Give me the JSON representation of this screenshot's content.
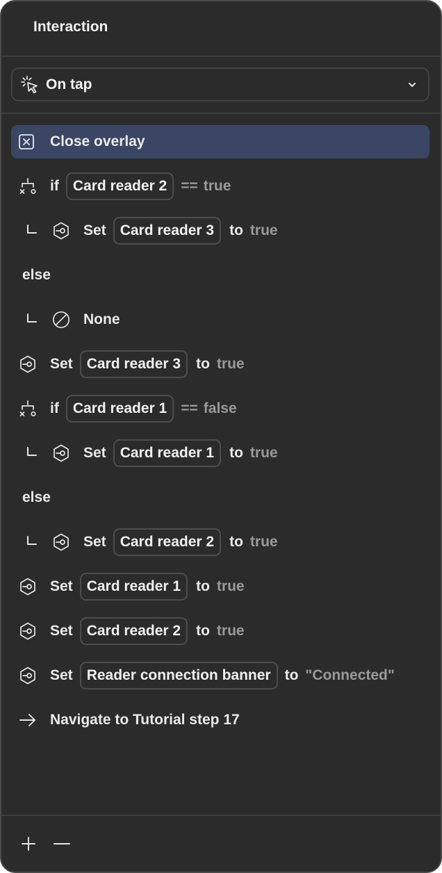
{
  "panel": {
    "title": "Interaction"
  },
  "trigger": {
    "icon": "tap-sparkle-icon",
    "label": "On tap"
  },
  "actions": [
    {
      "kind": "close",
      "label": "Close overlay"
    },
    {
      "kind": "if",
      "keyword": "if",
      "variable": "Card reader 2",
      "op": "==",
      "value": "true"
    },
    {
      "kind": "set",
      "indent": true,
      "keyword": "Set",
      "variable": "Card reader 3",
      "to": "to",
      "value": "true"
    },
    {
      "kind": "else",
      "label": "else"
    },
    {
      "kind": "none",
      "indent": true,
      "label": "None"
    },
    {
      "kind": "set",
      "keyword": "Set",
      "variable": "Card reader 3",
      "to": "to",
      "value": "true"
    },
    {
      "kind": "if",
      "keyword": "if",
      "variable": "Card reader 1",
      "op": "==",
      "value": "false"
    },
    {
      "kind": "set",
      "indent": true,
      "keyword": "Set",
      "variable": "Card reader 1",
      "to": "to",
      "value": "true"
    },
    {
      "kind": "else",
      "label": "else"
    },
    {
      "kind": "set",
      "indent": true,
      "keyword": "Set",
      "variable": "Card reader 2",
      "to": "to",
      "value": "true"
    },
    {
      "kind": "set",
      "keyword": "Set",
      "variable": "Card reader 1",
      "to": "to",
      "value": "true"
    },
    {
      "kind": "set",
      "keyword": "Set",
      "variable": "Card reader 2",
      "to": "to",
      "value": "true"
    },
    {
      "kind": "set",
      "keyword": "Set",
      "variable": "Reader connection banner",
      "to": "to",
      "value": "\"Connected\""
    },
    {
      "kind": "navigate",
      "label": "Navigate to Tutorial step 17"
    }
  ],
  "footer": {
    "add_icon": "plus-icon",
    "remove_icon": "minus-icon"
  },
  "colors": {
    "panel_bg": "#2b2b2b",
    "highlight": "#3a4663",
    "muted_text": "#9a9a9a"
  }
}
